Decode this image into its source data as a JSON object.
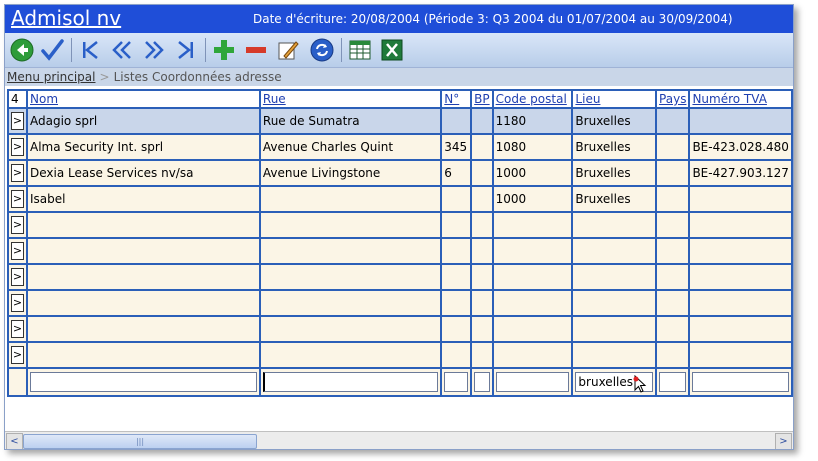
{
  "app": {
    "title": "Admisol nv",
    "date_info": "Date d'écriture: 20/08/2004 (Période 3: Q3 2004 du 01/07/2004 au 30/09/2004)"
  },
  "toolbar": {
    "icons": [
      "back-icon",
      "check-icon",
      "first-icon",
      "prev-icon",
      "next-icon",
      "last-icon",
      "add-icon",
      "remove-icon",
      "edit-icon",
      "refresh-icon",
      "list-icon",
      "excel-icon"
    ]
  },
  "breadcrumb": {
    "root": "Menu principal",
    "separator": ">",
    "current": "Listes Coordonnées adresse"
  },
  "grid": {
    "count": "4",
    "columns": [
      "Nom",
      "Rue",
      "N°",
      "BP",
      "Code postal",
      "Lieu",
      "Pays",
      "Numéro TVA"
    ],
    "row_button": ">",
    "rows": [
      {
        "nom": "Adagio sprl",
        "rue": "Rue de Sumatra",
        "no": "",
        "bp": "",
        "cp": "1180",
        "lieu": "Bruxelles",
        "pays": "",
        "tva": ""
      },
      {
        "nom": "Alma Security Int. sprl",
        "rue": "Avenue Charles Quint",
        "no": "345",
        "bp": "",
        "cp": "1080",
        "lieu": "Bruxelles",
        "pays": "",
        "tva": "BE-423.028.480"
      },
      {
        "nom": "Dexia Lease Services nv/sa",
        "rue": "Avenue Livingstone",
        "no": "6",
        "bp": "",
        "cp": "1000",
        "lieu": "Bruxelles",
        "pays": "",
        "tva": "BE-427.903.127"
      },
      {
        "nom": "Isabel",
        "rue": "",
        "no": "",
        "bp": "",
        "cp": "1000",
        "lieu": "Bruxelles",
        "pays": "",
        "tva": ""
      },
      {
        "nom": "",
        "rue": "",
        "no": "",
        "bp": "",
        "cp": "",
        "lieu": "",
        "pays": "",
        "tva": ""
      },
      {
        "nom": "",
        "rue": "",
        "no": "",
        "bp": "",
        "cp": "",
        "lieu": "",
        "pays": "",
        "tva": ""
      },
      {
        "nom": "",
        "rue": "",
        "no": "",
        "bp": "",
        "cp": "",
        "lieu": "",
        "pays": "",
        "tva": ""
      },
      {
        "nom": "",
        "rue": "",
        "no": "",
        "bp": "",
        "cp": "",
        "lieu": "",
        "pays": "",
        "tva": ""
      },
      {
        "nom": "",
        "rue": "",
        "no": "",
        "bp": "",
        "cp": "",
        "lieu": "",
        "pays": "",
        "tva": ""
      },
      {
        "nom": "",
        "rue": "",
        "no": "",
        "bp": "",
        "cp": "",
        "lieu": "",
        "pays": "",
        "tva": ""
      }
    ],
    "filter": {
      "nom": "",
      "rue": "",
      "no": "",
      "bp": "",
      "cp": "",
      "lieu": "bruxelles",
      "pays": "",
      "tva": ""
    }
  },
  "scrollbar": {
    "left_arrow": "<",
    "right_arrow": ">",
    "thumb_grip": "|||"
  }
}
